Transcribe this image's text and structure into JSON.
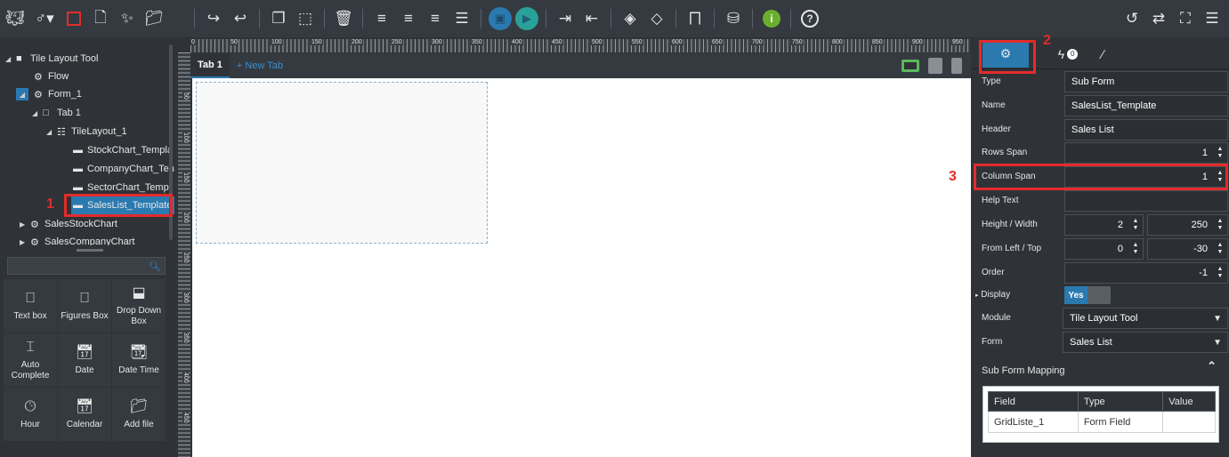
{
  "colors": {
    "accent": "#2a7ab0",
    "highlight": "#e32b2b",
    "panel": "#2f3338",
    "toolbar": "#343a40"
  },
  "toolbar": {
    "left_icons": [
      "octopus-logo-icon",
      "user-menu-icon",
      "red-square-icon",
      "new-file-icon",
      "magic-wand-icon",
      "folder-icon"
    ],
    "edit_icons": [
      "redo-icon",
      "undo-icon",
      "copy-icon",
      "cut-icon",
      "delete-icon"
    ],
    "align_icons": [
      "align-left-icon",
      "align-right-icon",
      "align-center-icon",
      "align-justify-icon"
    ],
    "right_icons": [
      "history-icon",
      "refresh-icon",
      "fullscreen-icon",
      "menu-icon"
    ]
  },
  "tree": {
    "items": [
      {
        "label": "Tile Layout Tool",
        "icon": "folder-icon"
      },
      {
        "label": "Flow",
        "icon": "cogs-icon"
      },
      {
        "label": "Form_1",
        "icon": "gear-icon"
      },
      {
        "label": "Tab 1",
        "icon": "tab-icon"
      },
      {
        "label": "TileLayout_1",
        "icon": "layout-icon"
      },
      {
        "label": "StockChart_Templa",
        "icon": "card-icon"
      },
      {
        "label": "CompanyChart_Ten",
        "icon": "card-icon"
      },
      {
        "label": "SectorChart_Templ",
        "icon": "card-icon"
      },
      {
        "label": "SalesList_Template",
        "icon": "card-icon"
      },
      {
        "label": "SalesStockChart",
        "icon": "gear-icon"
      },
      {
        "label": "SalesCompanyChart",
        "icon": "gear-icon"
      }
    ]
  },
  "annotations": {
    "one": "1",
    "two": "2",
    "three": "3"
  },
  "search": {
    "placeholder": ""
  },
  "palette": [
    {
      "label": "Text box",
      "icon": "textbox-icon"
    },
    {
      "label": "Figures Box",
      "icon": "figures-box-icon"
    },
    {
      "label": "Drop Down Box",
      "icon": "dropdown-box-icon"
    },
    {
      "label": "Auto Complete",
      "icon": "cursor-icon"
    },
    {
      "label": "Date",
      "icon": "date-icon"
    },
    {
      "label": "Date Time",
      "icon": "date-time-icon"
    },
    {
      "label": "Hour",
      "icon": "clock-icon"
    },
    {
      "label": "Calendar",
      "icon": "calendar-icon"
    },
    {
      "label": "Add file",
      "icon": "add-file-icon"
    }
  ],
  "ruler": {
    "top_ticks": [
      "0",
      "50",
      "100",
      "150",
      "200",
      "250",
      "300",
      "350",
      "400",
      "450",
      "500",
      "550",
      "600",
      "650",
      "700",
      "750",
      "800",
      "850",
      "900",
      "950"
    ],
    "left_ticks": [
      "50",
      "100",
      "150",
      "200",
      "250",
      "300",
      "350",
      "400",
      "450"
    ]
  },
  "tabs": {
    "active": "Tab 1",
    "new": "+ New Tab"
  },
  "properties": {
    "tabs": {
      "events_count": "0"
    },
    "type": {
      "label": "Type",
      "value": "Sub Form"
    },
    "name": {
      "label": "Name",
      "value": "SalesList_Template"
    },
    "header": {
      "label": "Header",
      "value": "Sales List"
    },
    "rows_span": {
      "label": "Rows Span",
      "value": "1"
    },
    "column_span": {
      "label": "Column Span",
      "value": "1"
    },
    "help_text": {
      "label": "Help Text",
      "value": ""
    },
    "height_width": {
      "label": "Height / Width",
      "height": "2",
      "width": "250"
    },
    "from_left_top": {
      "label": "From Left / Top",
      "left": "0",
      "top": "-30"
    },
    "order": {
      "label": "Order",
      "value": "-1"
    },
    "display": {
      "label": "Display",
      "value": "Yes"
    },
    "module": {
      "label": "Module",
      "value": "Tile Layout Tool"
    },
    "form": {
      "label": "Form",
      "value": "Sales List"
    },
    "mapping_title": "Sub Form Mapping"
  },
  "mapping": {
    "headers": [
      "Field",
      "Type",
      "Value"
    ],
    "rows": [
      [
        "GridListe_1",
        "Form Field",
        ""
      ]
    ]
  }
}
